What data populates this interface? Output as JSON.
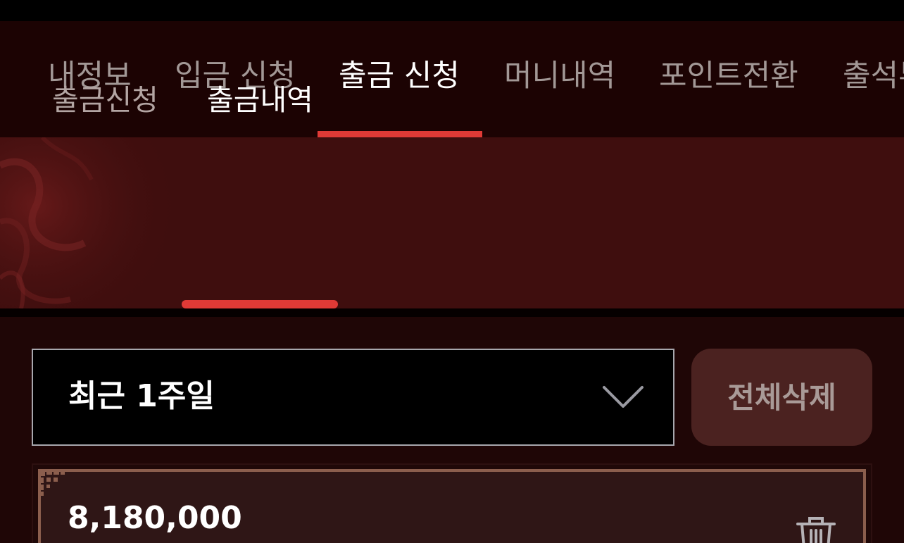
{
  "top_nav": {
    "tabs": [
      {
        "label": "내정보"
      },
      {
        "label": "입금 신청"
      },
      {
        "label": "출금 신청"
      },
      {
        "label": "머니내역"
      },
      {
        "label": "포인트전환"
      },
      {
        "label": "출석부"
      }
    ],
    "active_index": 2
  },
  "sub_nav": {
    "tabs": [
      {
        "label": "출금신청"
      },
      {
        "label": "출금내역"
      }
    ],
    "active_index": 1
  },
  "filter": {
    "period_selected": "최근 1주일",
    "delete_all_label": "전체삭제"
  },
  "history": {
    "items": [
      {
        "amount": "8,180,000"
      }
    ]
  },
  "icons": {
    "dropdown": "chevron-down-icon",
    "delete": "trash-icon"
  },
  "colors": {
    "accent": "#e03a36",
    "background": "#1f0606",
    "sub_nav_background": "#3f0e0e",
    "card_border": "#8b5e4d"
  }
}
